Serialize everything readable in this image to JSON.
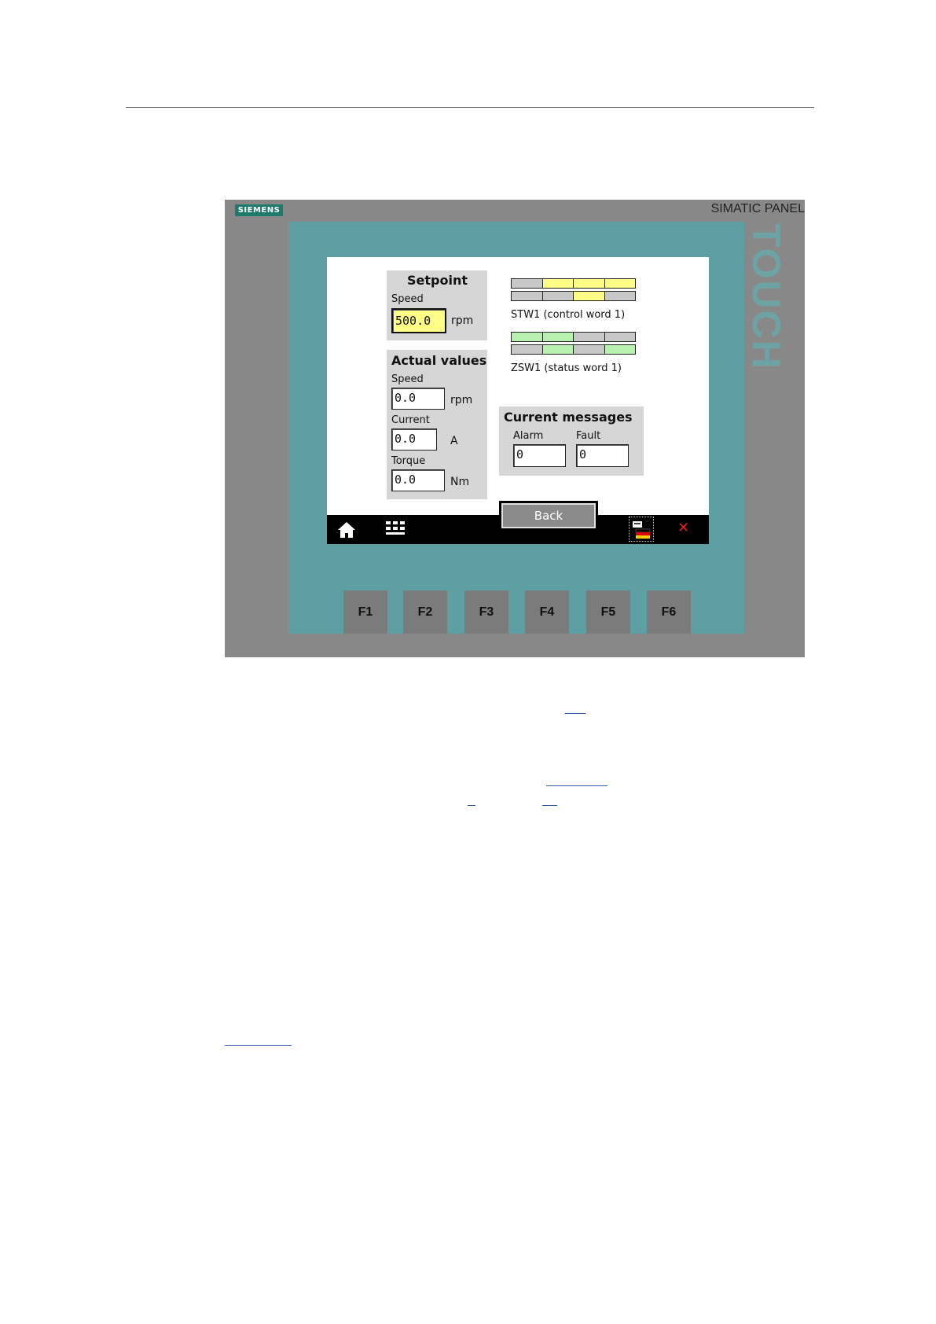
{
  "device": {
    "brand_logo": "SIEMENS",
    "brand_name": "SIMATIC PANEL",
    "touch_label": "TOUCH",
    "function_keys": [
      "F1",
      "F2",
      "F3",
      "F4",
      "F5",
      "F6"
    ]
  },
  "setpoint": {
    "title": "Setpoint",
    "speed_label": "Speed",
    "speed_value": "500.0",
    "speed_unit": "rpm"
  },
  "actual": {
    "title": "Actual values",
    "speed_label": "Speed",
    "speed_value": "0.0",
    "speed_unit": "rpm",
    "current_label": "Current",
    "current_value": "0.0",
    "current_unit": "A",
    "torque_label": "Torque",
    "torque_value": "0.0",
    "torque_unit": "Nm"
  },
  "stw1": {
    "label": "STW1 (control word 1)",
    "rows": [
      [
        "gray",
        "yellow",
        "yellow",
        "yellow"
      ],
      [
        "gray",
        "gray",
        "yellow",
        "gray"
      ]
    ]
  },
  "zsw1": {
    "label": "ZSW1 (status word 1)",
    "rows": [
      [
        "green",
        "green",
        "gray",
        "gray"
      ],
      [
        "gray",
        "green",
        "gray",
        "green"
      ]
    ]
  },
  "messages": {
    "title": "Current messages",
    "alarm_label": "Alarm",
    "alarm_value": "0",
    "fault_label": "Fault",
    "fault_value": "0"
  },
  "taskbar": {
    "back_label": "Back",
    "icons": [
      "home-icon",
      "grid-icon",
      "language-flag-icon",
      "close-icon"
    ]
  },
  "colors": {
    "bit_gray": "#c8c8c8",
    "bit_yellow": "#ffff88",
    "bit_green": "#b8f0b0",
    "bezel": "#5e9fa3",
    "device": "#888888"
  }
}
